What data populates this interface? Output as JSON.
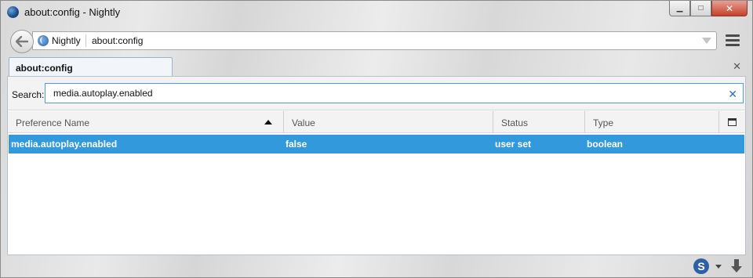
{
  "window": {
    "title": "about:config - Nightly"
  },
  "caption": {
    "minimize": "▁",
    "maximize": "□",
    "close": "✕"
  },
  "navbar": {
    "identity_label": "Nightly",
    "url": "about:config"
  },
  "tabs": [
    {
      "label": "about:config",
      "selected": true
    }
  ],
  "tabstrip": {
    "close_glyph": "✕"
  },
  "search": {
    "label": "Search:",
    "value": "media.autoplay.enabled",
    "clear_glyph": "✕"
  },
  "columns": [
    {
      "label": "Preference Name",
      "sorted": "ascending"
    },
    {
      "label": "Value"
    },
    {
      "label": "Status"
    },
    {
      "label": "Type"
    }
  ],
  "rows": [
    {
      "name": "media.autoplay.enabled",
      "value": "false",
      "status": "user set",
      "type": "boolean",
      "selected": true
    }
  ],
  "bottombar": {
    "sync_letter": "S"
  },
  "colors": {
    "selection": "#3399dd",
    "search_focus_border": "#4c9be8",
    "tab_background": "#f2f6fb"
  },
  "icons": [
    "app-icon",
    "back-arrow-icon",
    "globe-icon",
    "dropdown-arrow-icon",
    "hamburger-menu-icon",
    "tab-close-icon",
    "search-clear-icon",
    "sort-ascending-icon",
    "column-picker-icon",
    "sync-icon",
    "download-icon"
  ]
}
